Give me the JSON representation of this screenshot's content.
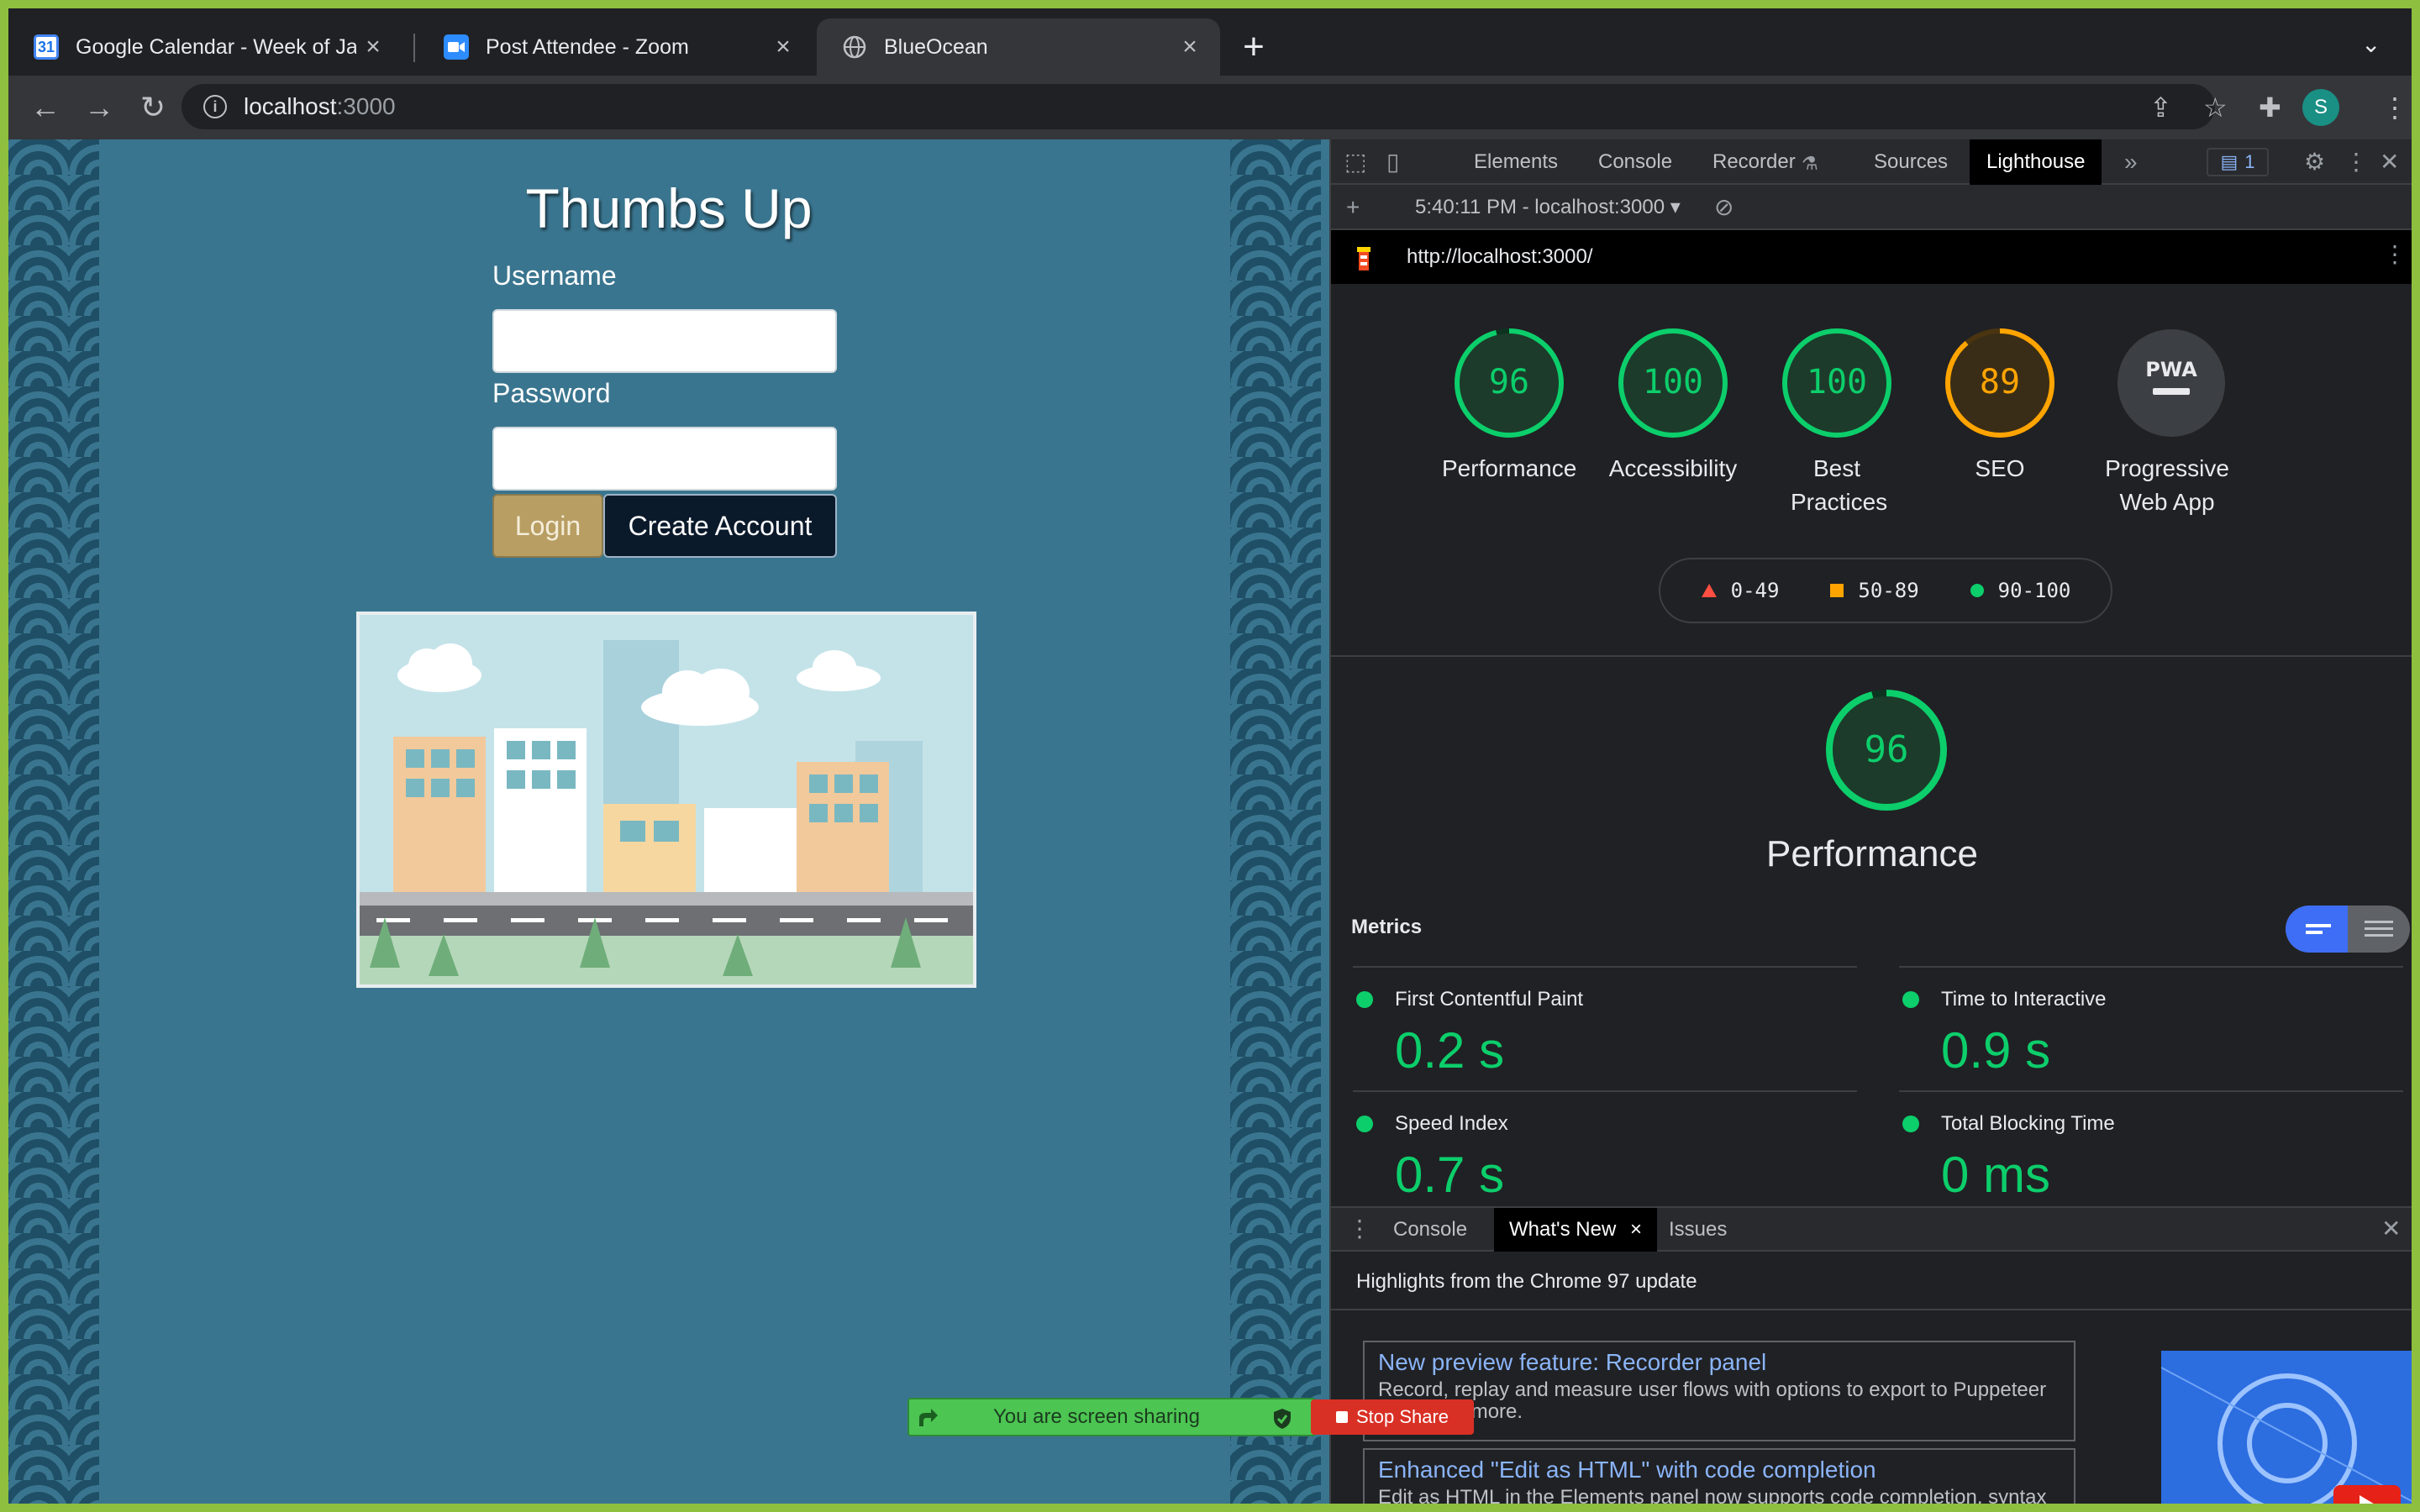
{
  "browser": {
    "tabs": [
      {
        "title": "Google Calendar - Week of Jan",
        "favicon": "calendar-icon",
        "active": false
      },
      {
        "title": "Post Attendee - Zoom",
        "favicon": "zoom-icon",
        "active": false
      },
      {
        "title": "BlueOcean",
        "favicon": "globe-icon",
        "active": true
      }
    ],
    "calendar_day": "31",
    "address": {
      "host": "localhost",
      "port": ":3000"
    },
    "profile_initial": "S"
  },
  "page": {
    "title": "Thumbs Up",
    "username_label": "Username",
    "password_label": "Password",
    "login_label": "Login",
    "create_label": "Create Account"
  },
  "devtools": {
    "tabs": [
      "Elements",
      "Console",
      "Recorder",
      "Sources",
      "Lighthouse"
    ],
    "active_tab": "Lighthouse",
    "issues_count": "1",
    "report_select": "5:40:11 PM - localhost:3000",
    "report_url": "http://localhost:3000/",
    "categories": [
      {
        "score": 96,
        "label": "Performance",
        "color": "#0cce6b"
      },
      {
        "score": 100,
        "label": "Accessibility",
        "color": "#0cce6b"
      },
      {
        "score": 100,
        "label": "Best Practices",
        "color": "#0cce6b"
      },
      {
        "score": 89,
        "label": "SEO",
        "color": "#ffa400"
      }
    ],
    "pwa": {
      "badge": "PWA",
      "label": "Progressive Web App"
    },
    "legend": {
      "fail": "0-49",
      "average": "50-89",
      "pass": "90-100"
    },
    "perf_score": 96,
    "perf_title": "Performance",
    "metrics_heading": "Metrics",
    "metrics": [
      {
        "name": "First Contentful Paint",
        "value": "0.2 s"
      },
      {
        "name": "Time to Interactive",
        "value": "0.9 s"
      },
      {
        "name": "Speed Index",
        "value": "0.7 s"
      },
      {
        "name": "Total Blocking Time",
        "value": "0 ms"
      }
    ],
    "drawer": {
      "tabs": [
        "Console",
        "What's New",
        "Issues"
      ],
      "highlights": "Highlights from the Chrome 97 update",
      "cards": [
        {
          "title": "New preview feature: Recorder panel",
          "desc": "Record, replay and measure user flows with options to export to Puppeteer script and more."
        },
        {
          "title": "Enhanced \"Edit as HTML\" with code completion",
          "desc": "Edit as HTML in the Elements panel now supports code completion, syntax highlights and more."
        }
      ]
    }
  },
  "zoom": {
    "sharing_text": "You are screen sharing",
    "stop_label": "Stop Share"
  },
  "colors": {
    "pass": "#0cce6b",
    "average": "#ffa400",
    "fail": "#ff4e42",
    "page_bg": "#3a758f"
  }
}
